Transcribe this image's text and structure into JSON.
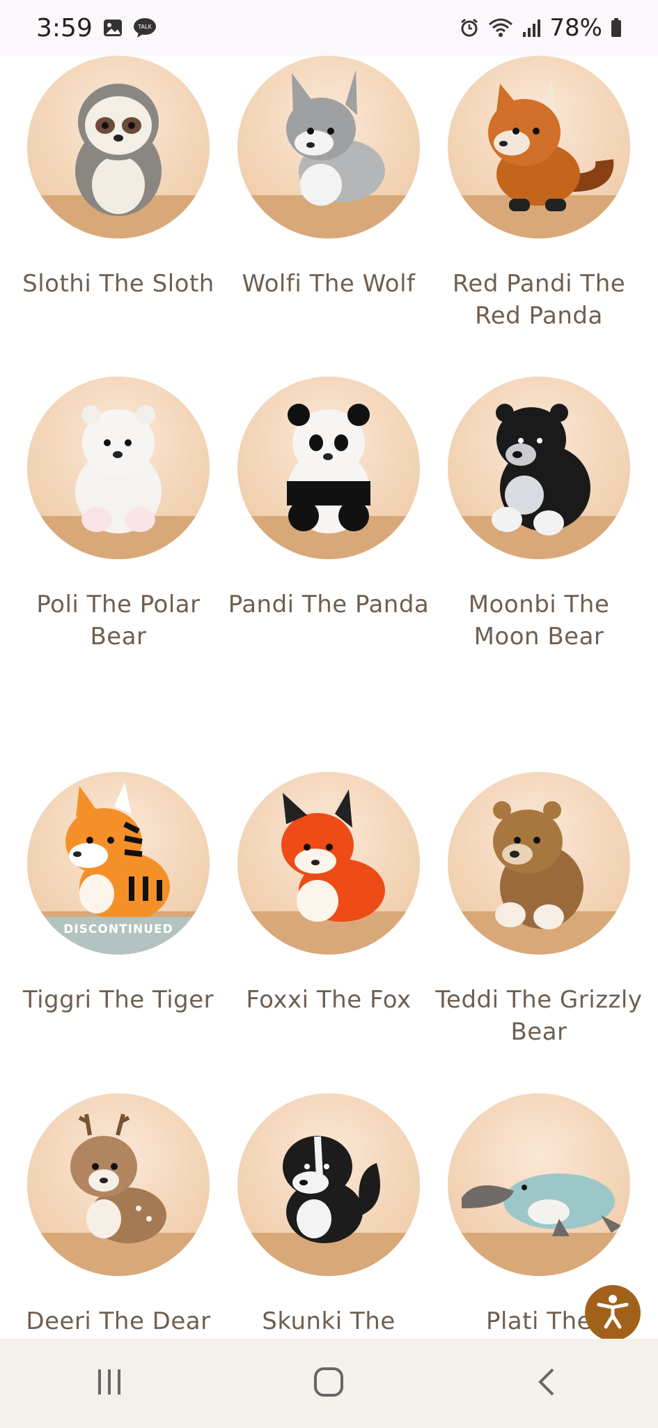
{
  "status": {
    "time": "3:59",
    "battery": "78%",
    "talk_badge": "TALK"
  },
  "products": [
    {
      "name": "Slothi The Sloth",
      "icon": "sloth"
    },
    {
      "name": "Wolfi The Wolf",
      "icon": "wolf"
    },
    {
      "name": "Red Pandi The Red Panda",
      "icon": "red-panda"
    },
    {
      "name": "Poli The Polar Bear",
      "icon": "polar-bear"
    },
    {
      "name": "Pandi The Panda",
      "icon": "panda"
    },
    {
      "name": "Moonbi The Moon Bear",
      "icon": "moon-bear"
    },
    {
      "name": "Tiggri The Tiger",
      "icon": "tiger",
      "badge": "DISCONTINUED"
    },
    {
      "name": "Foxxi The Fox",
      "icon": "fox"
    },
    {
      "name": "Teddi The Grizzly Bear",
      "icon": "grizzly-bear"
    },
    {
      "name": "Deeri The Dear",
      "icon": "deer"
    },
    {
      "name": "Skunki The",
      "icon": "skunk"
    },
    {
      "name": "Plati The",
      "icon": "platypus"
    }
  ],
  "colors": {
    "accent": "#a2611a",
    "text": "#6f5e50",
    "nav_bg": "#f4f1ea"
  }
}
